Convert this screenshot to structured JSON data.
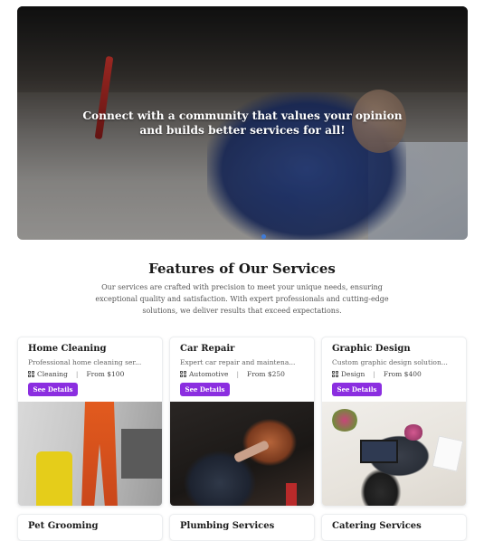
{
  "hero": {
    "text": "Connect with a community that values your opinion and builds better services for all!"
  },
  "section": {
    "title": "Features of Our Services",
    "description": "Our services are crafted with precision to meet your unique needs, ensuring exceptional quality and satisfaction. With expert professionals and cutting-edge solutions, we deliver results that exceed expectations."
  },
  "cards": [
    {
      "title": "Home Cleaning",
      "desc": "Professional home cleaning ser...",
      "category": "Cleaning",
      "price": "From $100",
      "button": "See Details"
    },
    {
      "title": "Car Repair",
      "desc": "Expert car repair and maintena...",
      "category": "Automotive",
      "price": "From $250",
      "button": "See Details"
    },
    {
      "title": "Graphic Design",
      "desc": "Custom graphic design solution...",
      "category": "Design",
      "price": "From $400",
      "button": "See Details"
    },
    {
      "title": "Pet Grooming"
    },
    {
      "title": "Plumbing Services"
    },
    {
      "title": "Catering Services"
    }
  ],
  "icons": {
    "category": "grid-icon"
  },
  "colors": {
    "button": "#8b2ee0",
    "carousel_dot": "#3f7bd9"
  }
}
